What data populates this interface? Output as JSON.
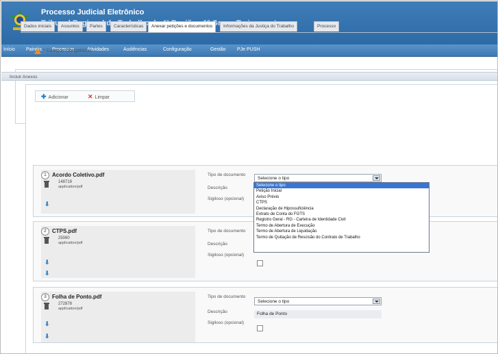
{
  "header": {
    "title": "Processo Judicial Eletrônico",
    "subtitle": "Tribunal Regional do Trabalho da 4ª Região - 1º Grau - Treinamento"
  },
  "menu": [
    "Início",
    "Painéis",
    "Processos",
    "Atividades",
    "Audiências",
    "Configuração",
    "Gestão",
    "PJe PUSH"
  ],
  "tabs": [
    {
      "label": "Dados iniciais",
      "active": false
    },
    {
      "label": "Assuntos",
      "active": false
    },
    {
      "label": "Partes",
      "active": false
    },
    {
      "label": "Características",
      "active": false
    },
    {
      "label": "Anexar petições e documentos",
      "active": true
    },
    {
      "label": "Informações da Justiça do Trabalho",
      "active": false
    },
    {
      "label": "Processo",
      "active": false
    }
  ],
  "required_note": "* Campos Obrigatórios",
  "include_header": "Incluir Anexos",
  "actions": {
    "add_label": "Adicionar",
    "clear_label": "Limpar"
  },
  "field_labels": {
    "doc_type": "Tipo de documento",
    "description": "Descrição",
    "secrecy": "Sigiloso (opcional)"
  },
  "documents": [
    {
      "num": "1",
      "name": "Acordo Coletivo.pdf",
      "size": "148719",
      "mime": "application/pdf",
      "type_value": "Selecione o tipo",
      "description": ""
    },
    {
      "num": "2",
      "name": "CTPS.pdf",
      "size": "25060",
      "mime": "application/pdf",
      "type_value": "",
      "description": ""
    },
    {
      "num": "3",
      "name": "Folha de Ponto.pdf",
      "size": "272878",
      "mime": "application/pdf",
      "type_value": "Selecione o tipo",
      "description": "Folha de Ponto"
    }
  ],
  "dropdown_options": [
    "Selecione o tipo",
    "Petição Inicial",
    "Aviso Prévio",
    "CTPS",
    "Declaração de Hipossuficiência",
    "Extrato de Conta do FGTS",
    "Registro Geral - RG - Carteira de Identidade Civil",
    "Termo de Abertura de Execução",
    "Termo de Abertura de Liquidação",
    "Termo de Quitação de Rescisão do Contrato de Trabalho"
  ],
  "colors": {
    "header": "#2d6aa6",
    "selected_option": "#3875d7",
    "warning": "#f28c1a"
  },
  "icons": [
    "brazil-crest-icon",
    "warning-icon",
    "add-icon",
    "clear-icon",
    "trash-icon",
    "arrow-down-icon"
  ]
}
